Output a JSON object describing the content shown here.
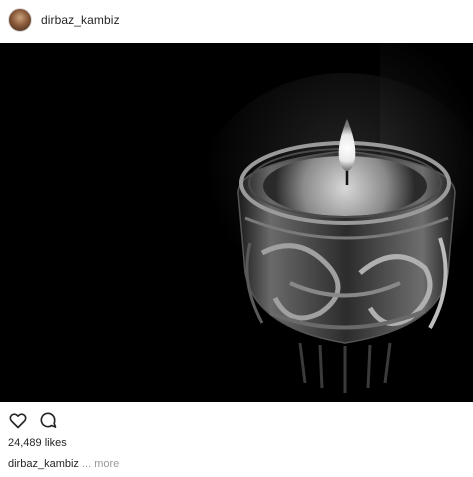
{
  "post": {
    "username": "dirbaz_kambiz",
    "likes": "24,489 likes",
    "caption_user": "dirbaz_kambiz",
    "caption_more": "... more"
  },
  "icons": {
    "like": "heart-icon",
    "comment": "comment-icon"
  },
  "colors": {
    "background": "#ffffff",
    "text": "#262626",
    "muted": "#999999",
    "photo_bg": "#000000"
  }
}
